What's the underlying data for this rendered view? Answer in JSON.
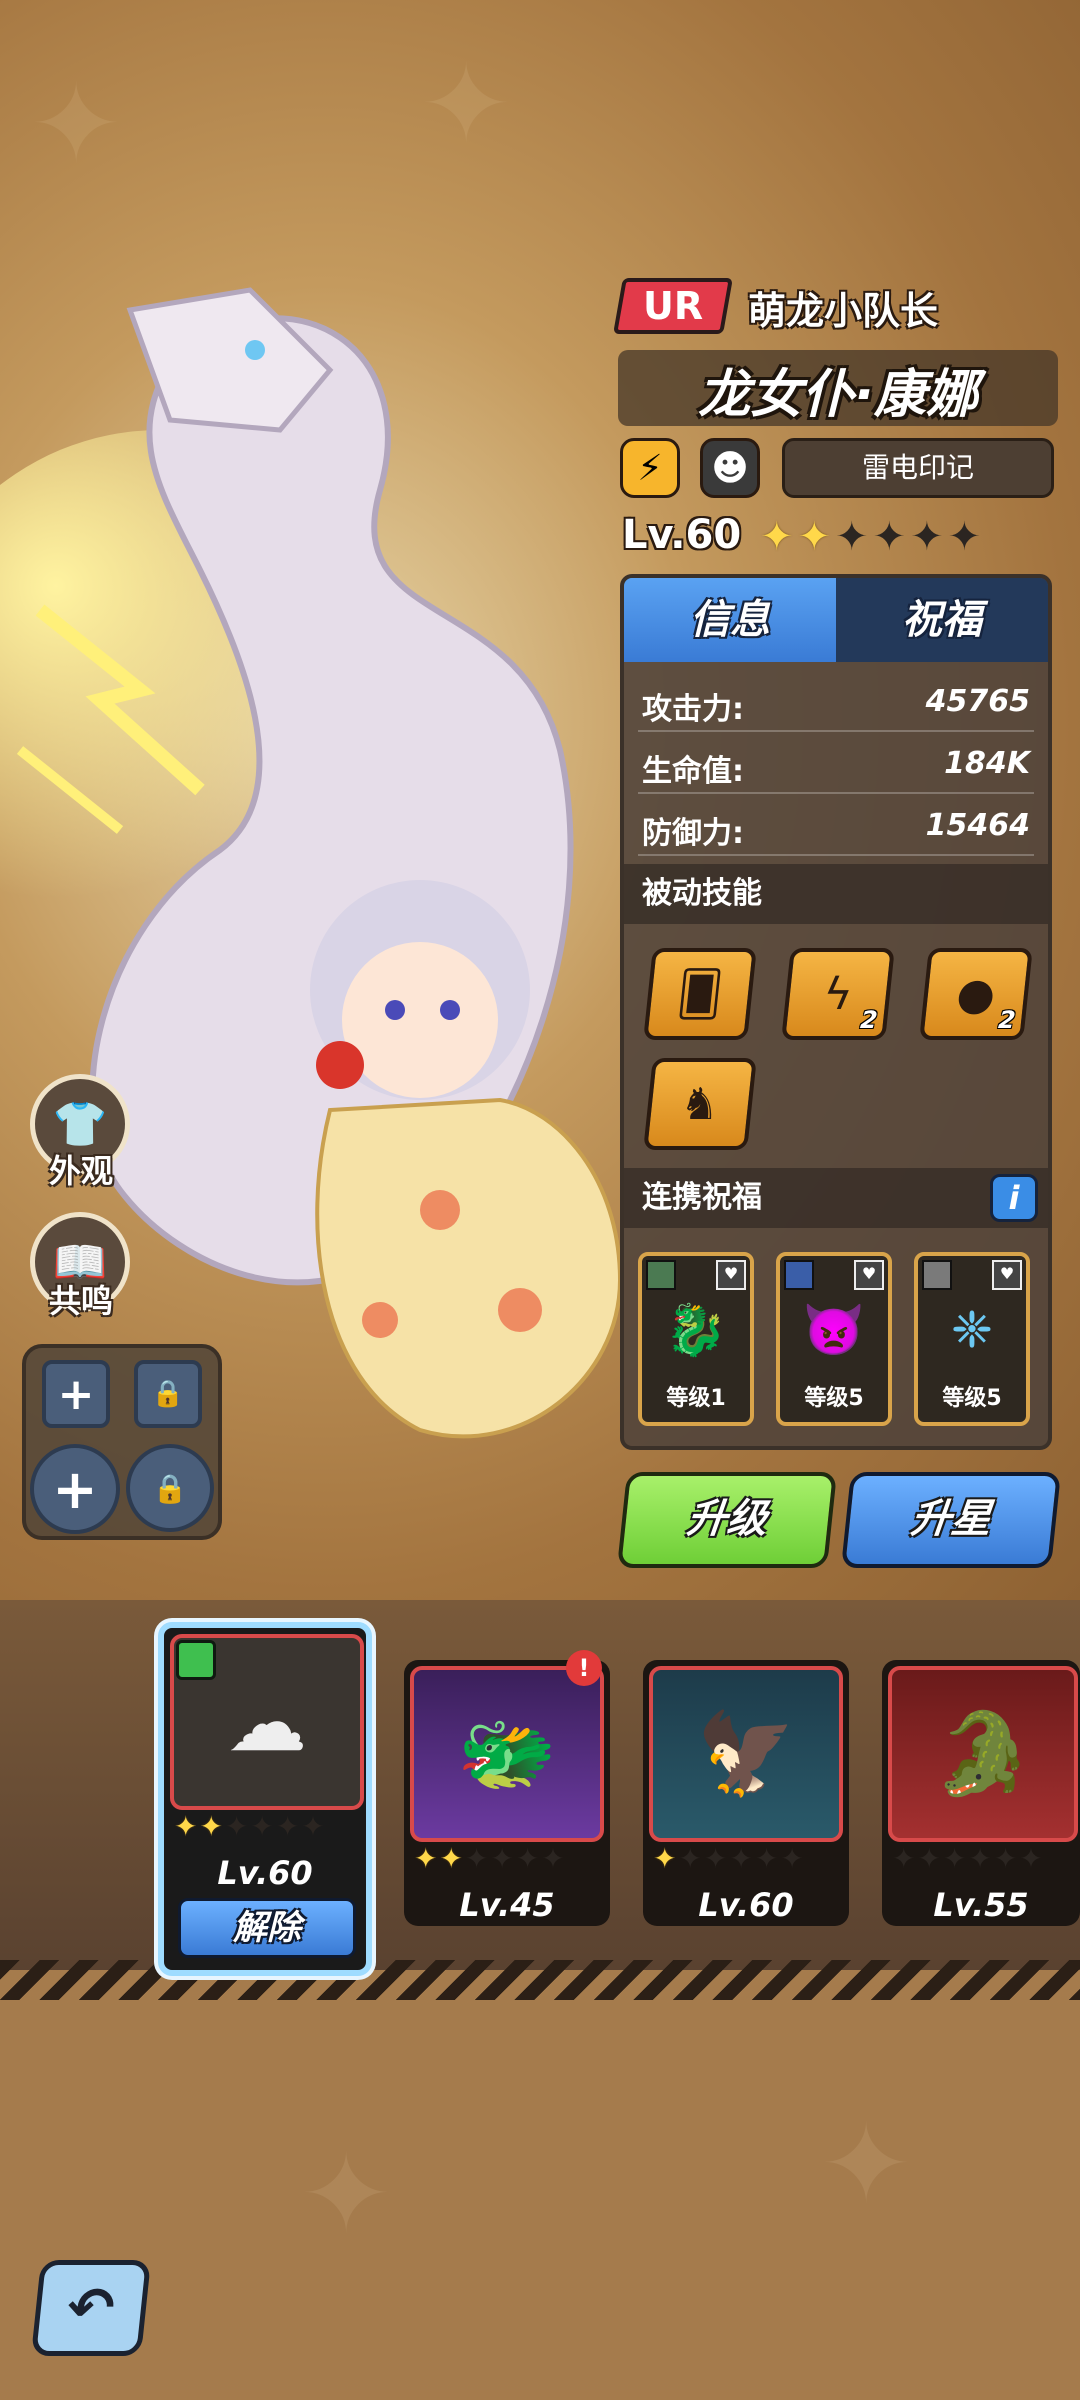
{
  "hero": {
    "rarity": "UR",
    "title": "萌龙小队长",
    "name": "龙女仆·康娜",
    "element_icon": "lightning-icon",
    "type_icon": "dragon-face-icon",
    "mark_label": "雷电印记",
    "level": "Lv.60",
    "stars_filled": 2,
    "stars_total": 6
  },
  "side": {
    "skin_label": "外观",
    "resonance_label": "共鸣"
  },
  "tabs": {
    "info": "信息",
    "blessing": "祝福"
  },
  "stats": [
    {
      "label": "攻击力:",
      "value": "45765"
    },
    {
      "label": "生命值:",
      "value": "184K"
    },
    {
      "label": "防御力:",
      "value": "15464"
    }
  ],
  "passive": {
    "title": "被动技能",
    "skills": [
      {
        "icon": "card-dice-icon",
        "count": ""
      },
      {
        "icon": "thunder-claw-icon",
        "count": "2"
      },
      {
        "icon": "fire-orb-icon",
        "count": "2"
      },
      {
        "icon": "horned-helmet-icon",
        "count": ""
      }
    ]
  },
  "link_blessing": {
    "title": "连携祝福",
    "info": "i",
    "items": [
      {
        "icon": "winged-dragon-icon",
        "level": "等级1"
      },
      {
        "icon": "demon-head-icon",
        "level": "等级5"
      },
      {
        "icon": "blue-spirit-icon",
        "level": "等级5"
      }
    ]
  },
  "actions": {
    "upgrade": "升级",
    "star_up": "升星"
  },
  "dragons": [
    {
      "level": "Lv.60",
      "stars": 2,
      "selected": true,
      "action": "解除"
    },
    {
      "level": "Lv.45",
      "stars": 2,
      "alert": "!"
    },
    {
      "level": "Lv.60",
      "stars": 1
    },
    {
      "level": "Lv.55",
      "stars": 0
    }
  ],
  "colors": {
    "accent_blue": "#3a7bd5",
    "upgrade_green": "#7fe24a",
    "rarity_red": "#e23a4a",
    "star_gold": "#ffd84a"
  }
}
